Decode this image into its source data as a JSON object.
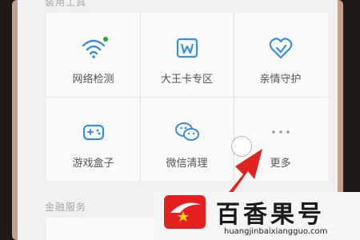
{
  "sections": {
    "tools_title": "装用工具",
    "finance_title": "金融服务"
  },
  "tiles": [
    {
      "label": "网络检测",
      "icon": "wifi-icon"
    },
    {
      "label": "大王卡专区",
      "icon": "king-card-icon"
    },
    {
      "label": "亲情守护",
      "icon": "heart-shield-icon"
    },
    {
      "label": "游戏盒子",
      "icon": "gamepad-icon"
    },
    {
      "label": "微信清理",
      "icon": "wechat-icon"
    },
    {
      "label": "更多",
      "icon": "more-dots-icon"
    }
  ],
  "watermark": {
    "name": "百香果号",
    "url": "huangjinbaixiangguo.com"
  },
  "colors": {
    "icon_blue": "#3a8fd6",
    "dot_green": "#1aad19",
    "arrow_red": "#e0231f"
  }
}
